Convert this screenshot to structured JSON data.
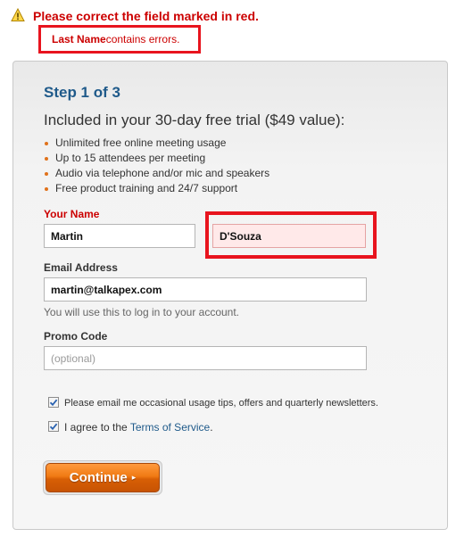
{
  "error_banner": {
    "title": "Please correct the field marked in red.",
    "field_name": "Last Name",
    "field_message": " contains errors."
  },
  "form": {
    "step_label": "Step 1 of 3",
    "trial_heading": "Included in your 30-day free trial ($49 value):",
    "benefits": [
      "Unlimited free online meeting usage",
      "Up to 15 attendees per meeting",
      "Audio via telephone and/or mic and speakers",
      "Free product training and 24/7 support"
    ],
    "your_name_label": "Your Name",
    "first_name_value": "Martin",
    "last_name_value": "D'Souza",
    "email_label": "Email Address",
    "email_value": "martin@talkapex.com",
    "email_hint": "You will use this to log in to your account.",
    "promo_label": "Promo Code",
    "promo_placeholder": "(optional)",
    "newsletter_label": "Please email me occasional usage tips, offers and quarterly newsletters.",
    "newsletter_checked": true,
    "agree_prefix": "I agree to the ",
    "tos_link": "Terms of Service",
    "agree_suffix": ".",
    "agree_checked": true,
    "continue_label": "Continue",
    "continue_arrow": "▸"
  },
  "colors": {
    "error_red": "#cc0000",
    "highlight_red": "#e8141e",
    "title_blue": "#1f5a8a",
    "bullet_orange": "#e0721b",
    "button_orange": "#f07a14"
  },
  "icons": {
    "warning": "warning-icon",
    "checkbox": "checkmark-icon"
  }
}
